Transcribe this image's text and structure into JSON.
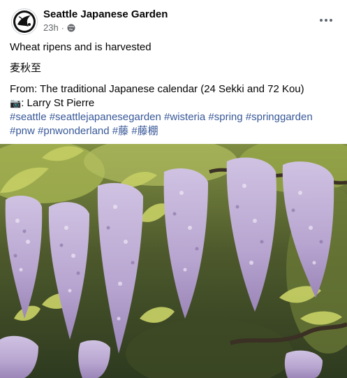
{
  "post": {
    "page_name": "Seattle Japanese Garden",
    "time": "23h",
    "separator": "·",
    "privacy_icon": "globe-icon",
    "more_icon": "more-options-icon",
    "lines": {
      "l1": "Wheat ripens and is harvested",
      "l2": "麦秋至",
      "l3": "From: The traditional Japanese calendar (24 Sekki and 72 Kou)",
      "l4_icon": "camera-icon",
      "l4": ": Larry St Pierre"
    },
    "hashtags": [
      "#seattle",
      "#seattlejapanesegarden",
      "#wisteria",
      "#spring",
      "#springgarden",
      "#pnw",
      "#pnwonderland",
      "#藤",
      "#藤棚"
    ],
    "image": {
      "subject": "wisteria"
    }
  },
  "colors": {
    "link": "#385898",
    "secondary_text": "#65676b",
    "wisteria": "#b9a7cf",
    "leaves": "#9fae4a"
  }
}
